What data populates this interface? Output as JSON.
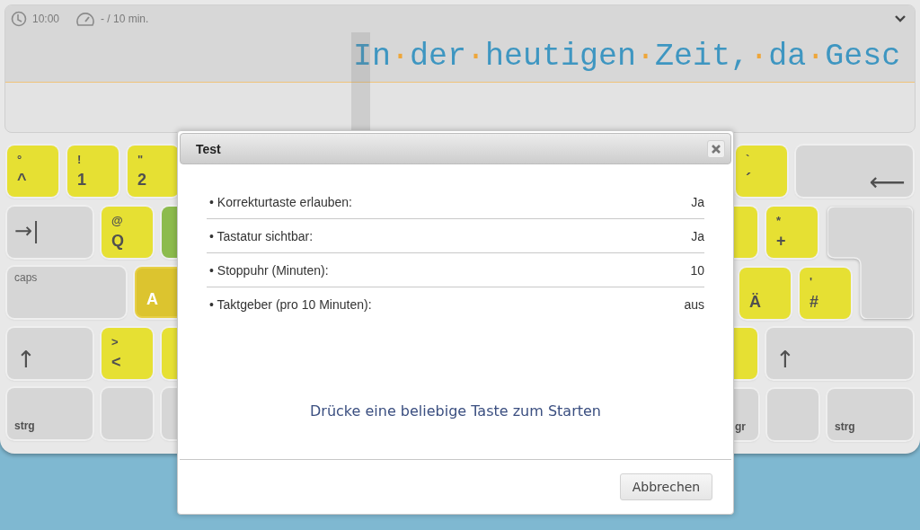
{
  "status": {
    "time": "10:00",
    "pace": "- / 10 min."
  },
  "typing_line": {
    "words": [
      "In",
      "der",
      "heutigen",
      "Zeit,",
      "da",
      "Gesc"
    ],
    "space_marker": "·"
  },
  "keyboard": {
    "left_rows": [
      [
        {
          "kind": "char",
          "top": "°",
          "label": "^",
          "color": "#e6e033",
          "highlighted": false
        },
        {
          "kind": "char",
          "top": "!",
          "label": "1",
          "color": "#e6e033",
          "highlighted": false
        },
        {
          "kind": "char",
          "top": "\"",
          "label": "2",
          "color": "#e6e033",
          "highlighted": false
        }
      ],
      [
        {
          "kind": "tab",
          "label": "→|"
        },
        {
          "kind": "char",
          "top": "@",
          "label": "Q",
          "color": "#e6e033",
          "highlighted": false
        },
        {
          "kind": "char",
          "color": "#8cbb4d",
          "highlighted": false
        }
      ],
      [
        {
          "kind": "caps",
          "label": "caps"
        },
        {
          "kind": "char",
          "label": "A",
          "color": "#dcc42f",
          "highlighted": true
        }
      ],
      [
        {
          "kind": "shift",
          "label": "↑"
        },
        {
          "kind": "char",
          "top": ">",
          "label": "<",
          "color": "#e6e033",
          "highlighted": false
        },
        {
          "kind": "char",
          "color": "#e6e033",
          "highlighted": false
        }
      ],
      [
        {
          "kind": "ctrl",
          "label": "strg"
        },
        {
          "kind": "blank"
        },
        {
          "kind": "blank"
        }
      ]
    ],
    "right_rows": [
      [
        {
          "kind": "char",
          "top": "`",
          "label": "´",
          "color": "#e6e033",
          "highlighted": false
        },
        {
          "kind": "backspace",
          "label": "⟵"
        }
      ],
      [
        {
          "kind": "char",
          "color": "#e6e033",
          "highlighted": false
        },
        {
          "kind": "char",
          "top": "*",
          "label": "+",
          "color": "#e6e033",
          "highlighted": false
        },
        {
          "kind": "enter"
        }
      ],
      [
        {
          "kind": "char",
          "label": "Ä",
          "color": "#e6e033",
          "highlighted": false
        },
        {
          "kind": "char",
          "top": "'",
          "label": "#",
          "color": "#e6e033",
          "highlighted": false
        }
      ],
      [
        {
          "kind": "char",
          "color": "#e6e033",
          "highlighted": false
        },
        {
          "kind": "shift-wide",
          "label": "↑"
        }
      ],
      [
        {
          "kind": "altgr",
          "label": "gr"
        },
        {
          "kind": "blank"
        },
        {
          "kind": "ctrl",
          "label": "strg"
        }
      ]
    ]
  },
  "dialog": {
    "title": "Test",
    "settings": [
      {
        "label": "• Korrekturtaste erlauben:",
        "value": "Ja"
      },
      {
        "label": "• Tastatur sichtbar:",
        "value": "Ja"
      },
      {
        "label": "• Stoppuhr (Minuten):",
        "value": "10"
      },
      {
        "label": "• Taktgeber (pro 10 Minuten):",
        "value": "aus"
      }
    ],
    "message": "Drücke eine beliebige Taste zum Starten",
    "buttons": [
      {
        "label": "Abbrechen"
      }
    ]
  }
}
